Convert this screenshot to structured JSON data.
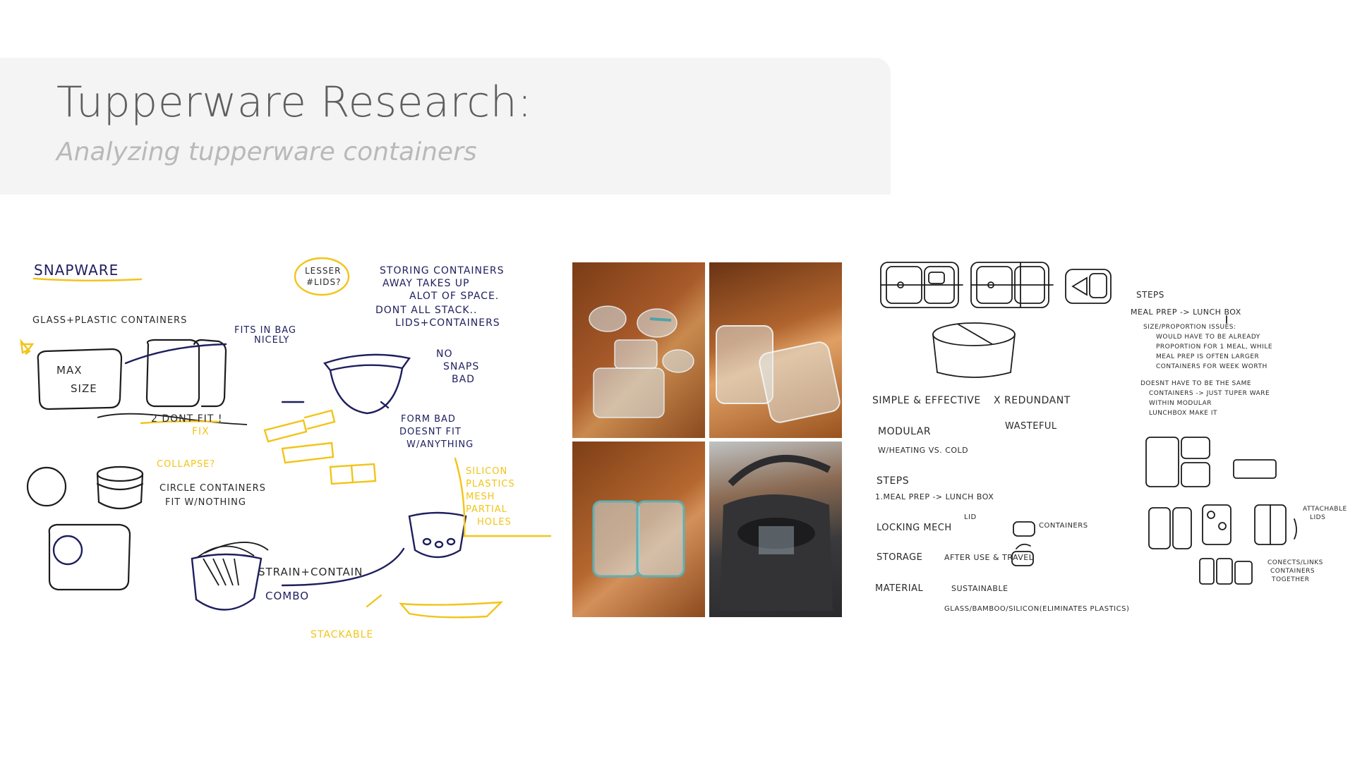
{
  "header": {
    "title": "Tupperware Research:",
    "subtitle": "Analyzing tupperware containers"
  },
  "sketch_left": {
    "heading": "SNAPWARE",
    "glass_plastic": "GLASS+PLASTIC CONTAINERS",
    "fits_in_bag": "FITS IN BAG",
    "nicely": "NICELY",
    "max_size": [
      "MAX",
      "SIZE"
    ],
    "lesser_lids": [
      "LESSER",
      "#LIDS?"
    ],
    "storing_notes": [
      "STORING CONTAINERS",
      "AWAY TAKES UP",
      "ALOT OF SPACE.",
      "DONT ALL STACK..",
      "LIDS+CONTAINERS"
    ],
    "no_snaps": [
      "NO",
      "SNAPS",
      "BAD"
    ],
    "form_bad": [
      "FORM BAD",
      "DOESNT FIT",
      "W/ANYTHING"
    ],
    "two_dont_fit": "2 DONT FIT !",
    "fix": "FIX",
    "collapse": "COLLAPSE?",
    "circle_containers": "CIRCLE CONTAINERS",
    "fit_nothing": "FIT W/NOTHING",
    "materials": [
      "SILICON",
      "PLASTICS",
      "MESH",
      "PARTIAL",
      "HOLES"
    ],
    "strain_contain": "STRAIN+CONTAIN",
    "combo": "COMBO",
    "stackable": "STACKABLE"
  },
  "sketch_right": {
    "simple": "SIMPLE & EFFECTIVE",
    "redundant": "X REDUNDANT",
    "wasteful": "WASTEFUL",
    "modular": "MODULAR",
    "heating": "W/HEATING VS. COLD",
    "steps": "STEPS",
    "meal_prep_steps": "1.MEAL PREP -> LUNCH BOX",
    "locking": "LOCKING MECH",
    "lid": "LID",
    "containers": "CONTAINERS",
    "storage": "STORAGE",
    "after_use": "AFTER USE & TRAVEL",
    "material": "MATERIAL",
    "sustainable": "SUSTAINABLE",
    "materials_list": "GLASS/BAMBOO/SILICON(ELIMINATES PLASTICS)",
    "steps_heading": "STEPS",
    "meal_prep": "MEAL PREP -> LUNCH BOX",
    "notes": [
      "SIZE/PROPORTION ISSUES:",
      "WOULD HAVE TO BE ALREADY",
      "PROPORTION FOR 1 MEAL, WHILE",
      "MEAL PREP IS OFTEN LARGER",
      "CONTAINERS FOR WEEK WORTH"
    ],
    "doesnt_have": [
      "DOESNT HAVE TO BE THE SAME",
      "CONTAINERS -> JUST TUPER WARE",
      "WITHIN MODULAR",
      "LUNCHBOX    MAKE IT"
    ],
    "attachable_lids": [
      "ATTACHABLE",
      "LIDS"
    ],
    "connects": [
      "CONECTS/LINKS",
      "CONTAINERS",
      "TOGETHER"
    ]
  },
  "colors": {
    "header_bg": "#f4f4f4",
    "title": "#5f5f5f",
    "subtitle": "#b9b9b9",
    "navy_ink": "#1e1f5e",
    "yellow_ink": "#f2c419",
    "floor_wood": "#9a4f22"
  }
}
